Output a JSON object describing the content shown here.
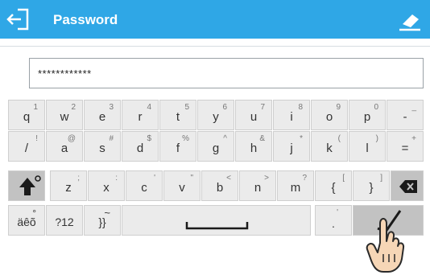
{
  "header": {
    "title": "Password",
    "back_icon": "back-arrow-icon",
    "clear_icon": "eraser-icon",
    "color": "#2fa7e6"
  },
  "input": {
    "value": "************"
  },
  "keyboard": {
    "row1": [
      {
        "main": "q",
        "sec": "1"
      },
      {
        "main": "w",
        "sec": "2"
      },
      {
        "main": "e",
        "sec": "3"
      },
      {
        "main": "r",
        "sec": "4"
      },
      {
        "main": "t",
        "sec": "5"
      },
      {
        "main": "y",
        "sec": "6"
      },
      {
        "main": "u",
        "sec": "7"
      },
      {
        "main": "i",
        "sec": "8"
      },
      {
        "main": "o",
        "sec": "9"
      },
      {
        "main": "p",
        "sec": "0"
      },
      {
        "main": "-",
        "sec": "_"
      }
    ],
    "row2": [
      {
        "main": "/",
        "sec": "!"
      },
      {
        "main": "a",
        "sec": "@"
      },
      {
        "main": "s",
        "sec": "#"
      },
      {
        "main": "d",
        "sec": "$"
      },
      {
        "main": "f",
        "sec": "%"
      },
      {
        "main": "g",
        "sec": "^"
      },
      {
        "main": "h",
        "sec": "&"
      },
      {
        "main": "j",
        "sec": "*"
      },
      {
        "main": "k",
        "sec": "("
      },
      {
        "main": "l",
        "sec": ")"
      },
      {
        "main": "=",
        "sec": "+"
      }
    ],
    "row3": [
      {
        "main": "z",
        "sec": ";"
      },
      {
        "main": "x",
        "sec": ":"
      },
      {
        "main": "c",
        "sec": "'"
      },
      {
        "main": "v",
        "sec": "\""
      },
      {
        "main": "b",
        "sec": "<"
      },
      {
        "main": "n",
        "sec": ">"
      },
      {
        "main": "m",
        "sec": "?"
      },
      {
        "main": "{",
        "sec": "["
      },
      {
        "main": "}",
        "sec": "]"
      }
    ],
    "shift_icon": "shift-arrow-icon",
    "backspace_icon": "backspace-icon",
    "accent_key": "äêõ",
    "accent_key_sec": "°",
    "symbols_key": "?12",
    "brackets_key": "}}",
    "brackets_key_sec": "~",
    "space_icon": "space-bar-icon",
    "dot_key": ".",
    "dot_key_sec": "'",
    "enter_icon": "checkmark-icon",
    "pointer_icon": "hand-pointer-icon"
  }
}
